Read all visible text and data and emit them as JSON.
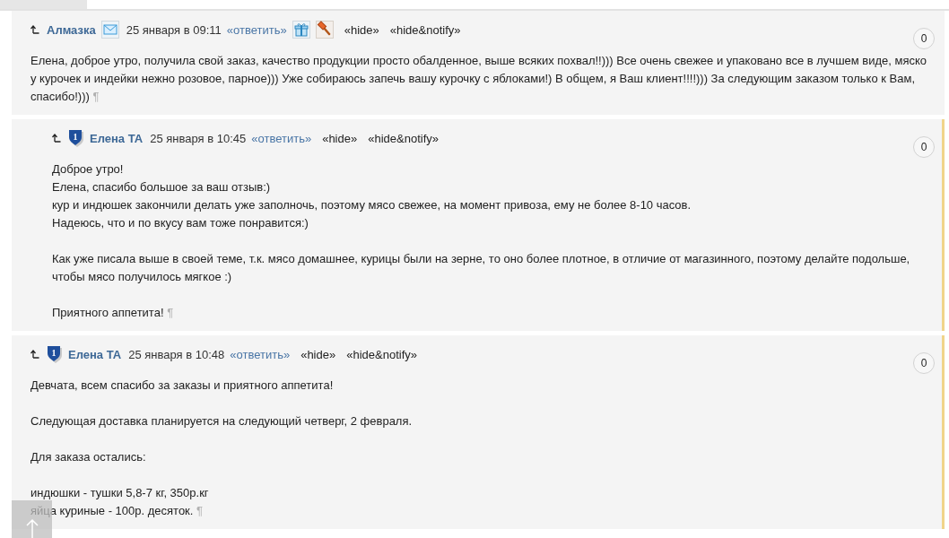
{
  "comments": [
    {
      "author": "Алмазка",
      "icons_after_author": [
        {
          "kind": "mail"
        }
      ],
      "date": "25 января в 09:11",
      "reply": "«ответить»",
      "icons_after_reply": [
        {
          "kind": "gift"
        },
        {
          "kind": "hammer"
        }
      ],
      "hide": "«hide»",
      "hide_notify": "«hide&notify»",
      "score": "0",
      "new": false,
      "paragraphs": [
        [
          "Елена, доброе утро, получила свой заказ, качество продукции просто обалденное, выше всяких похвал!!))) Все очень свежее и упаковано все в лучшем виде, мяско у курочек и индейки нежно розовое, парное))) Уже собираюсь запечь вашу курочку с яблоками!) В общем, я Ваш клиент!!!!))) За следующим заказом только к Вам, спасибо!)))"
        ]
      ],
      "pilcrow": "¶",
      "children": [
        {
          "author": "Елена ТА",
          "badge": {
            "kind": "shield",
            "label": "1"
          },
          "date": "25 января в 10:45",
          "reply": "«ответить»",
          "hide": "«hide»",
          "hide_notify": "«hide&notify»",
          "score": "0",
          "new": true,
          "paragraphs": [
            [
              "Доброе утро!",
              "Елена, спасибо большое за ваш отзыв:)",
              "кур и индюшек закончили делать уже заполночь, поэтому мясо свежее, на момент привоза, ему не более 8-10 часов.",
              "Надеюсь, что и по вкусу вам тоже понравится:)"
            ],
            [
              "Как уже писала выше в своей теме, т.к. мясо домашнее, курицы были на зерне, то оно более плотное, в отличие от магазинного, поэтому делайте подольше, чтобы мясо получилось мягкое :)"
            ],
            [
              "Приятного аппетита!"
            ]
          ],
          "pilcrow": "¶"
        }
      ]
    },
    {
      "author": "Елена ТА",
      "badge": {
        "kind": "shield",
        "label": "1"
      },
      "date": "25 января в 10:48",
      "reply": "«ответить»",
      "hide": "«hide»",
      "hide_notify": "«hide&notify»",
      "score": "0",
      "new": true,
      "paragraphs": [
        [
          "Девчата, всем спасибо за заказы и приятного аппетита!"
        ],
        [
          "Следующая доставка планируется на следующий четверг, 2 февраля."
        ],
        [
          "Для заказа остались:"
        ],
        [
          "индюшки - тушки 5,8-7 кг, 350р.кг",
          "яйца куриные - 100р. десяток."
        ]
      ],
      "pilcrow": "¶"
    }
  ]
}
